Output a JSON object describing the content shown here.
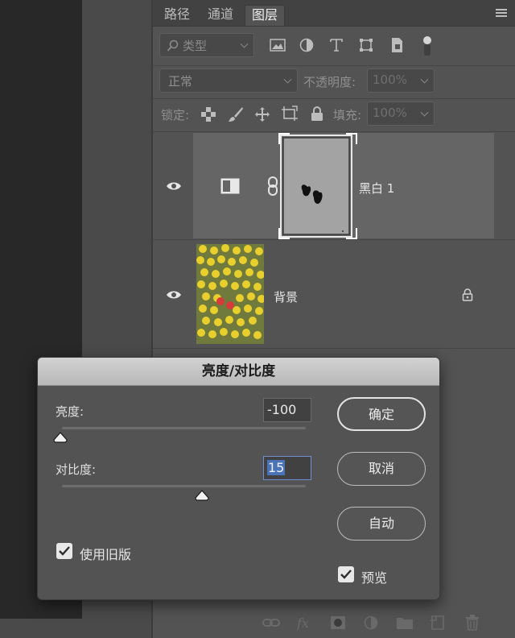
{
  "tabs": [
    "路径",
    "通道",
    "图层"
  ],
  "filter": {
    "label": "类型"
  },
  "blend": {
    "mode": "正常",
    "opacity_label": "不透明度:",
    "opacity_value": "100%"
  },
  "lock": {
    "label": "锁定:",
    "fill_label": "填充:",
    "fill_value": "100%"
  },
  "layers": [
    {
      "name": "黑白 1"
    },
    {
      "name": "背景"
    }
  ],
  "dialog": {
    "title": "亮度/对比度",
    "brightness_label": "亮度:",
    "brightness_value": "-100",
    "contrast_label": "对比度:",
    "contrast_value": "15",
    "ok_label": "确定",
    "cancel_label": "取消",
    "auto_label": "自动",
    "legacy_label": "使用旧版",
    "preview_label": "预览"
  },
  "colors": {
    "panel": "#535353",
    "canvas": "#282828",
    "selected_layer": "#656565",
    "dialog_title": "#c6c6c6",
    "focus": "#6e8ed1"
  }
}
